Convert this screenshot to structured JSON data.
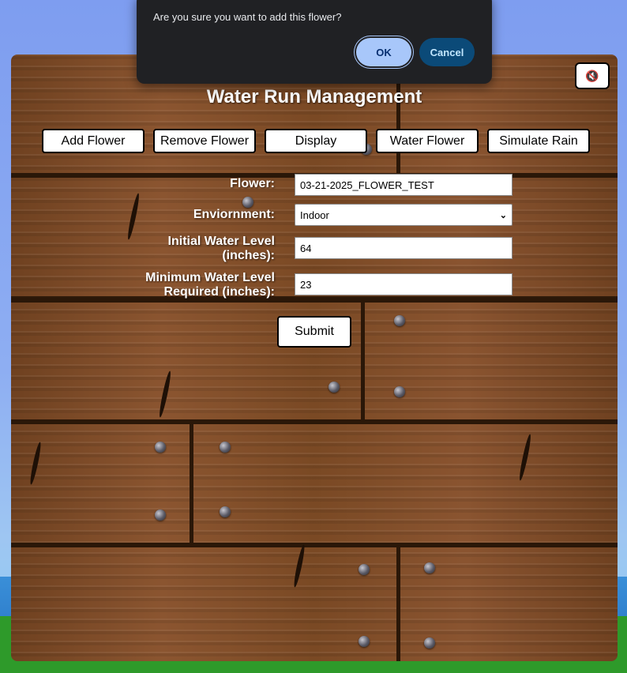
{
  "dialog": {
    "message": "Are you sure you want to add this flower?",
    "ok_label": "OK",
    "cancel_label": "Cancel"
  },
  "header": {
    "title": "Water Run Management",
    "mute_icon": "speaker-muted-icon",
    "mute_glyph": "🔇"
  },
  "nav": {
    "add": "Add Flower",
    "remove": "Remove Flower",
    "display": "Display",
    "water": "Water Flower",
    "rain": "Simulate Rain"
  },
  "form": {
    "flower_label": "Flower:",
    "flower_value": "03-21-2025_FLOWER_TEST",
    "environment_label": "Enviornment:",
    "environment_value": "Indoor",
    "initial_label_1": "Initial Water Level",
    "initial_label_2": "(inches):",
    "initial_value": "64",
    "minimum_label_1": "Minimum Water Level",
    "minimum_label_2": "Required (inches):",
    "minimum_value": "23",
    "submit_label": "Submit"
  },
  "colors": {
    "wood": "#7a4a22",
    "ok_button": "#a8c7fa",
    "cancel_button": "#0b4a78",
    "dialog_bg": "#202124"
  }
}
